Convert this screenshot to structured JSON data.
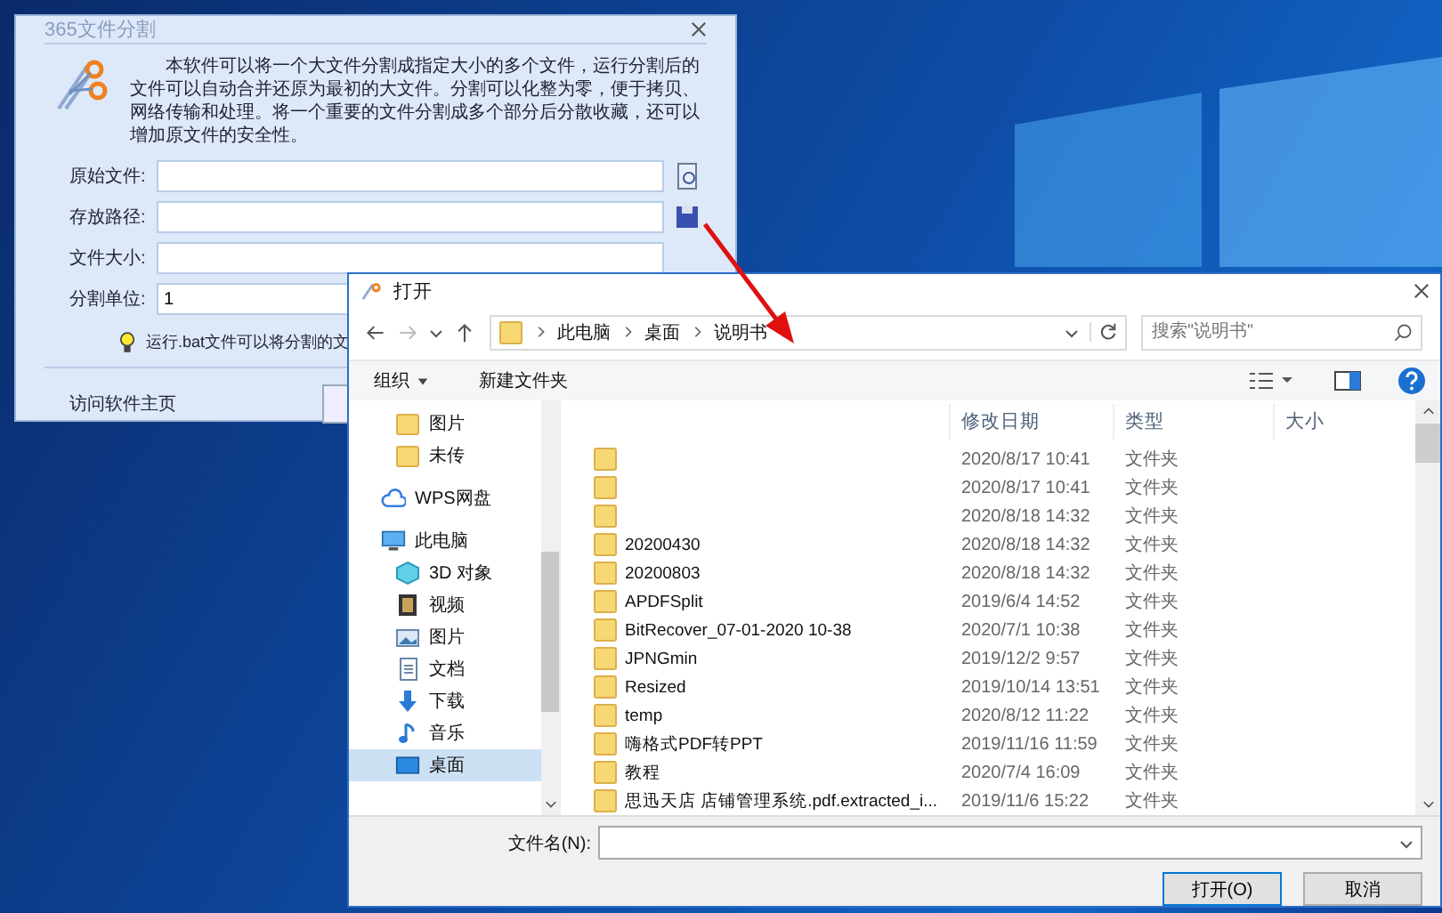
{
  "app_window": {
    "title": "365文件分割",
    "description": "本软件可以将一个大文件分割成指定大小的多个文件，运行分割后的文件可以自动合并还原为最初的大文件。分割可以化整为零，便于拷贝、网络传输和处理。将一个重要的文件分割成多个部分后分散收藏，还可以增加原文件的安全性。",
    "fields": [
      {
        "label": "原始文件:",
        "kind": "open"
      },
      {
        "label": "存放路径:",
        "kind": "save"
      },
      {
        "label": "文件大小:",
        "kind": "plain"
      },
      {
        "label": "分割单位:",
        "kind": "plain",
        "value": "1"
      }
    ],
    "tip": "运行.bat文件可以将分割的文",
    "homepage_link": "访问软件主页"
  },
  "open_dialog": {
    "title": "打开",
    "breadcrumbs": [
      "此电脑",
      "桌面",
      "说明书"
    ],
    "search": {
      "placeholder": "搜索\"说明书\""
    },
    "toolbar": {
      "organize": "组织",
      "new_folder": "新建文件夹"
    },
    "nav": {
      "continued_items": [
        {
          "label": "图片",
          "kind": "folder",
          "selected": false
        },
        {
          "label": "未传",
          "kind": "folder",
          "selected": false
        }
      ],
      "items": [
        {
          "label": "WPS网盘",
          "kind": "cloud",
          "selected": false
        },
        {
          "label": "此电脑",
          "kind": "pc",
          "selected": false,
          "children": [
            {
              "label": "3D 对象",
              "kind": "cube",
              "selected": false
            },
            {
              "label": "视频",
              "kind": "video",
              "selected": false
            },
            {
              "label": "图片",
              "kind": "picture",
              "selected": false
            },
            {
              "label": "文档",
              "kind": "doc",
              "selected": false
            },
            {
              "label": "下载",
              "kind": "download",
              "selected": false
            },
            {
              "label": "音乐",
              "kind": "music",
              "selected": false
            },
            {
              "label": "桌面",
              "kind": "desktop",
              "selected": true
            }
          ]
        }
      ]
    },
    "columns": [
      "修改日期",
      "类型",
      "大小"
    ],
    "rows": [
      {
        "modified": "2020/8/17 10:41",
        "type": "文件夹",
        "selected": false
      },
      {
        "modified": "2020/8/17 10:41",
        "type": "文件夹",
        "selected": false
      },
      {
        "modified": "2020/8/18 14:32",
        "type": "文件夹",
        "selected": false
      },
      {
        "name": "20200430",
        "modified": "2020/8/18 14:32",
        "type": "文件夹",
        "selected": false
      },
      {
        "name": "20200803",
        "modified": "2020/8/18 14:32",
        "type": "文件夹",
        "selected": false
      },
      {
        "name": "APDFSplit",
        "modified": "2019/6/4 14:52",
        "type": "文件夹",
        "selected": false
      },
      {
        "name": "BitRecover_07-01-2020 10-38",
        "modified": "2020/7/1 10:38",
        "type": "文件夹",
        "selected": false
      },
      {
        "name": "JPNGmin",
        "modified": "2019/12/2 9:57",
        "type": "文件夹",
        "selected": false
      },
      {
        "name": "Resized",
        "modified": "2019/10/14 13:51",
        "type": "文件夹",
        "selected": false
      },
      {
        "name": "temp",
        "modified": "2020/8/12 11:22",
        "type": "文件夹",
        "selected": false
      },
      {
        "name": "嗨格式PDF转PPT",
        "modified": "2019/11/16 11:59",
        "type": "文件夹",
        "selected": false
      },
      {
        "name": "教程",
        "modified": "2020/7/4 16:09",
        "type": "文件夹",
        "selected": false
      },
      {
        "name": "思迅天店 店铺管理系统.pdf.extracted_i...",
        "modified": "2019/11/6 15:22",
        "type": "文件夹",
        "selected": false
      }
    ],
    "filename_label": "文件名(N):",
    "buttons": [
      "打开(O)",
      "取消"
    ]
  }
}
